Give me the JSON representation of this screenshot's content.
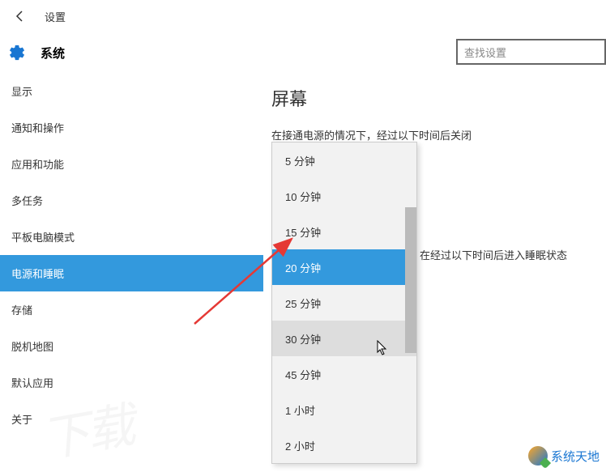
{
  "header": {
    "title": "设置"
  },
  "subheader": {
    "title": "系统",
    "search_placeholder": "查找设置"
  },
  "sidebar": {
    "items": [
      {
        "label": "显示"
      },
      {
        "label": "通知和操作"
      },
      {
        "label": "应用和功能"
      },
      {
        "label": "多任务"
      },
      {
        "label": "平板电脑模式"
      },
      {
        "label": "电源和睡眠"
      },
      {
        "label": "存储"
      },
      {
        "label": "脱机地图"
      },
      {
        "label": "默认应用"
      },
      {
        "label": "关于"
      }
    ],
    "selected_index": 5
  },
  "main": {
    "page_title": "屏幕",
    "screen_off_label": "在接通电源的情况下，经过以下时间后关闭",
    "sleep_label": "在经过以下时间后进入睡眠状态",
    "select_value": "15 分钟",
    "dropdown": {
      "options": [
        "5 分钟",
        "10 分钟",
        "15 分钟",
        "20 分钟",
        "25 分钟",
        "30 分钟",
        "45 分钟",
        "1 小时",
        "2 小时"
      ],
      "highlighted_index": 3,
      "hover_index": 5
    }
  },
  "watermark": {
    "text": "系统天地"
  }
}
